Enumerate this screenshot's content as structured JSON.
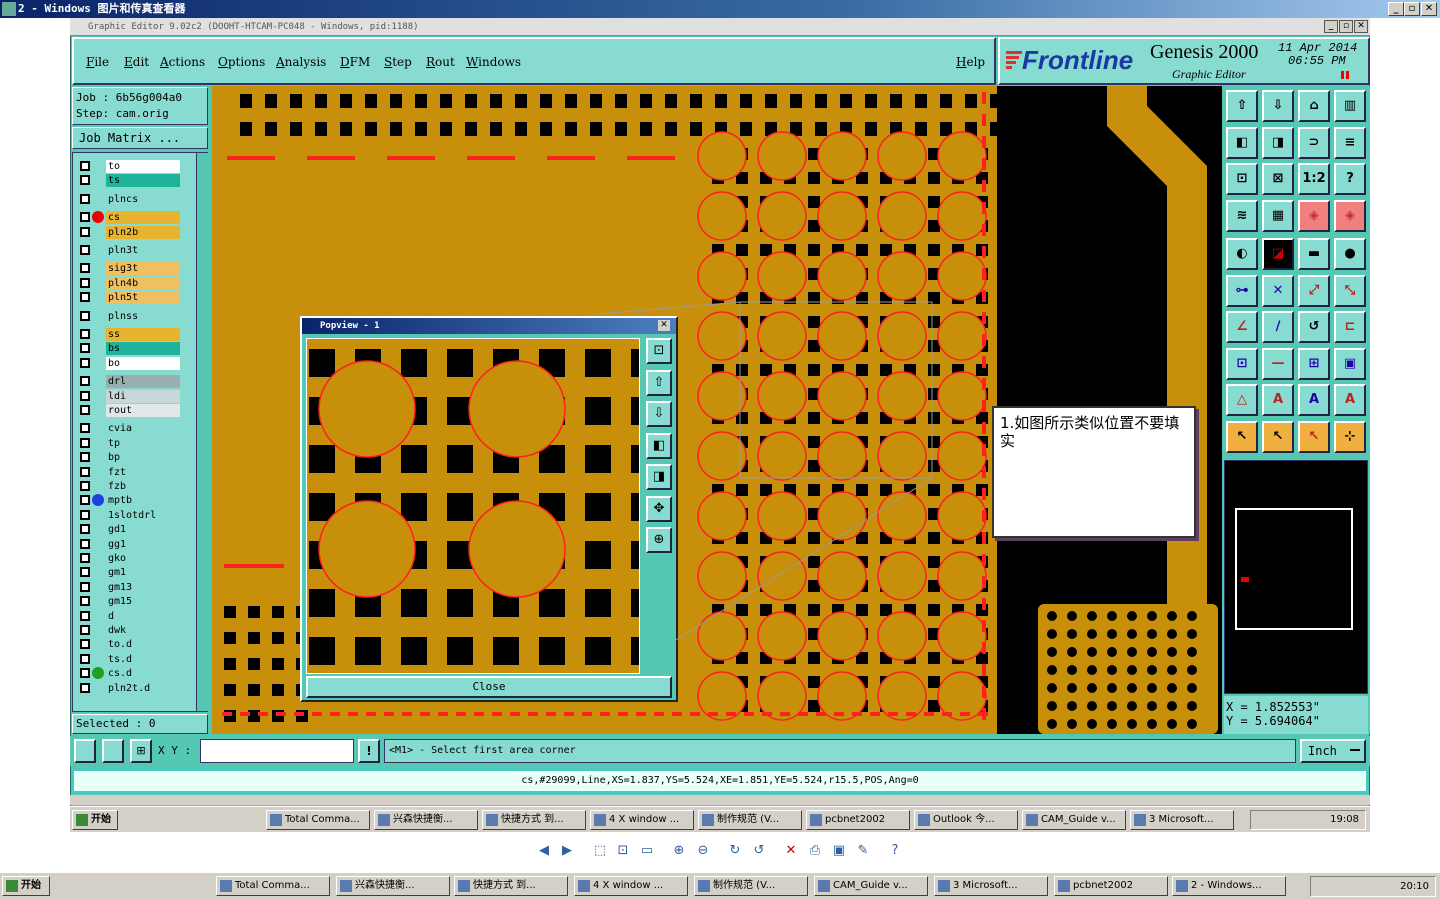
{
  "viewer": {
    "title": "2 - Windows 图片和传真查看器",
    "min": "_",
    "max": "▫",
    "close": "✕"
  },
  "genesis": {
    "title": "Graphic Editor 9.02c2  (DOOHT-HTCAM-PC048 - Windows, pid:1188)",
    "menus": [
      "File",
      "Edit",
      "Actions",
      "Options",
      "Analysis",
      "DFM",
      "Step",
      "Rout",
      "Windows"
    ],
    "help": "Help",
    "brand": "Frontline",
    "product": "Genesis 2000",
    "subtitle": "Graphic Editor",
    "date": "11 Apr 2014",
    "time": "06:55 PM"
  },
  "job": {
    "job_line": "Job : 6b56g004a0",
    "step_line": "Step: cam.orig",
    "matrix_button": "Job Matrix ..."
  },
  "layers": [
    {
      "name": "to",
      "color": "#ffffff"
    },
    {
      "name": "ts",
      "color": "#20b39b"
    },
    {
      "name": "plncs",
      "color": "#88dbd0"
    },
    {
      "name": "cs",
      "color": "#e8b430"
    },
    {
      "name": "pln2b",
      "color": "#e8b430"
    },
    {
      "name": "pln3t",
      "color": "#88dbd0"
    },
    {
      "name": "sig3t",
      "color": "#f0c060"
    },
    {
      "name": "pln4b",
      "color": "#f0c060"
    },
    {
      "name": "pln5t",
      "color": "#f0c060"
    },
    {
      "name": "plnss",
      "color": "#88dbd0"
    },
    {
      "name": "ss",
      "color": "#e8b430"
    },
    {
      "name": "bs",
      "color": "#20b39b"
    },
    {
      "name": "bo",
      "color": "#ffffff"
    },
    {
      "name": "drl",
      "color": "#9ab0b0"
    },
    {
      "name": "ldi",
      "color": "#c8d8d8"
    },
    {
      "name": "rout",
      "color": "#e0e8e8"
    },
    {
      "name": "cvia",
      "color": "#88dbd0"
    },
    {
      "name": "tp",
      "color": "#88dbd0"
    },
    {
      "name": "bp",
      "color": "#88dbd0"
    },
    {
      "name": "fzt",
      "color": "#88dbd0"
    },
    {
      "name": "fzb",
      "color": "#88dbd0"
    },
    {
      "name": "mptb",
      "color": "#88dbd0"
    },
    {
      "name": "1slotdrl",
      "color": "#88dbd0"
    },
    {
      "name": "gd1",
      "color": "#88dbd0"
    },
    {
      "name": "gg1",
      "color": "#88dbd0"
    },
    {
      "name": "gko",
      "color": "#88dbd0"
    },
    {
      "name": "gm1",
      "color": "#88dbd0"
    },
    {
      "name": "gm13",
      "color": "#88dbd0"
    },
    {
      "name": "gm15",
      "color": "#88dbd0"
    },
    {
      "name": "d",
      "color": "#88dbd0"
    },
    {
      "name": "dwk",
      "color": "#88dbd0"
    },
    {
      "name": "to.d",
      "color": "#88dbd0"
    },
    {
      "name": "ts.d",
      "color": "#88dbd0"
    },
    {
      "name": "cs.d",
      "color": "#88dbd0"
    },
    {
      "name": "pln2t.d",
      "color": "#88dbd0"
    }
  ],
  "selected": "Selected : 0",
  "popview": {
    "title": "Popview - 1",
    "close_label": "Close"
  },
  "note": "1.如图所示类似位置不要填实",
  "coords": {
    "x": "X = 1.852553\"",
    "y": "Y = 5.694064\""
  },
  "command": {
    "xy_label": "X Y :",
    "xy_value": "",
    "prompt": "<M1> - Select first area corner",
    "units": "Inch"
  },
  "status": "cs,#29099,Line,XS=1.837,YS=5.524,XE=1.851,YE=5.524,r15.5,POS,Ang=0",
  "inner_taskbar": {
    "start": "开始",
    "items": [
      "Total Comma...",
      "兴森快捷衡...",
      "快捷方式 到...",
      "4 X window ...",
      "制作规范 (V...",
      "pcbnet2002",
      "Outlook 今...",
      "CAM_Guide v...",
      "3 Microsoft..."
    ],
    "clock": "19:08"
  },
  "outer_taskbar": {
    "start": "开始",
    "items": [
      "Total Comma...",
      "兴森快捷衡...",
      "快捷方式 到...",
      "4 X window ...",
      "制作规范 (V...",
      "CAM_Guide v...",
      "3 Microsoft...",
      "pcbnet2002",
      "2 - Windows..."
    ],
    "clock": "20:10"
  },
  "colors": {
    "board": "#c8900a",
    "copper_dark": "#000000",
    "outline": "#ff2020",
    "panel": "#55c8b4",
    "panel_light": "#88dbd0"
  }
}
